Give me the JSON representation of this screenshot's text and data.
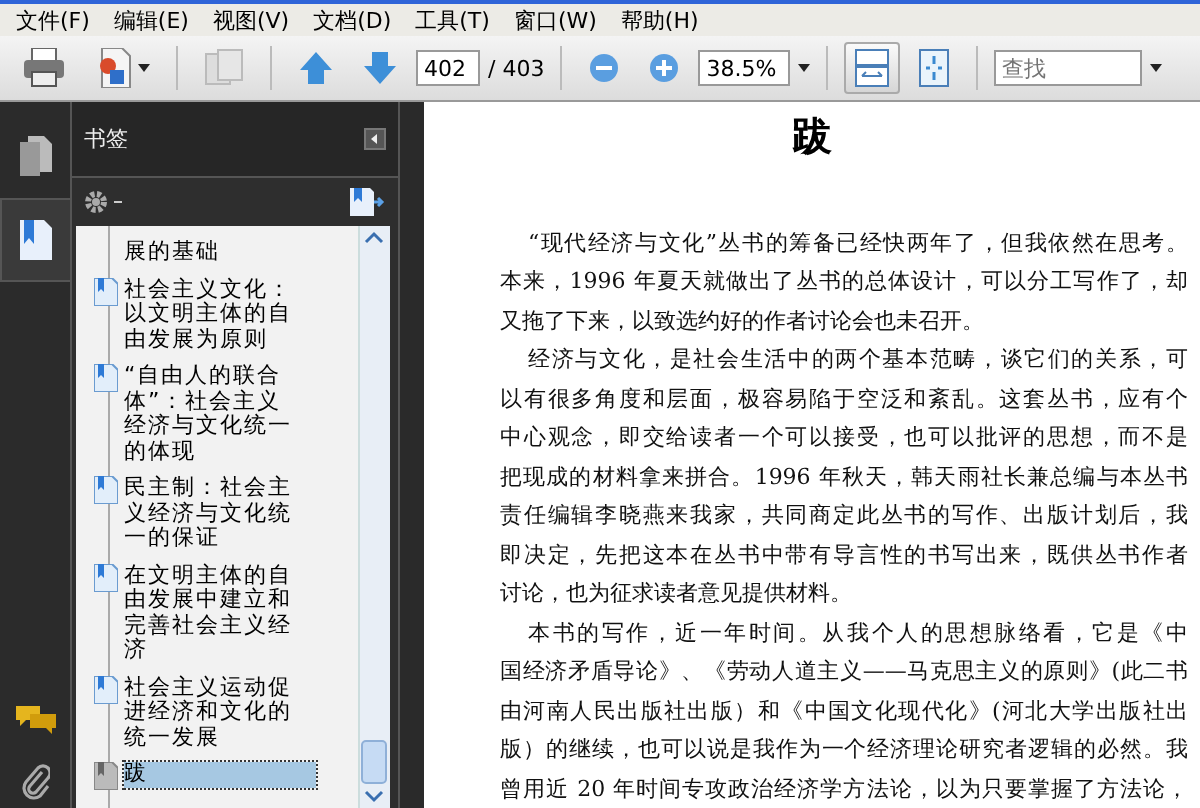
{
  "menu": [
    {
      "label": "文件(F)"
    },
    {
      "label": "编辑(E)"
    },
    {
      "label": "视图(V)"
    },
    {
      "label": "文档(D)"
    },
    {
      "label": "工具(T)"
    },
    {
      "label": "窗口(W)"
    },
    {
      "label": "帮助(H)"
    }
  ],
  "toolbar": {
    "page_field": {
      "value": "402"
    },
    "page_total": "/ 403",
    "zoom_field": {
      "value": "38.5%"
    },
    "view_buttons": [
      {
        "kind": "fit-width",
        "selected": true
      },
      {
        "kind": "fit-page",
        "selected": false
      }
    ],
    "search": {
      "placeholder": "查找"
    }
  },
  "nav_strip": {
    "items": [
      {
        "kind": "pages",
        "selected": false
      },
      {
        "kind": "bookmarks",
        "selected": true
      }
    ],
    "bottom": [
      {
        "kind": "comments"
      },
      {
        "kind": "attachments"
      }
    ]
  },
  "panel": {
    "title": "书签",
    "bookmarks": [
      {
        "kind": "continued",
        "text": "展的基础",
        "selected": false
      },
      {
        "kind": "bookmark",
        "text": "社会主义文化：以文明主体的自由发展为原则",
        "selected": false
      },
      {
        "kind": "bookmark",
        "text": "“自由人的联合体”：社会主义经济与文化统一的体现",
        "selected": false
      },
      {
        "kind": "bookmark",
        "text": "民主制：社会主义经济与文化统一的保证",
        "selected": false
      },
      {
        "kind": "bookmark",
        "text": "在文明主体的自由发展中建立和完善社会主义经济",
        "selected": false
      },
      {
        "kind": "bookmark",
        "text": "社会主义运动促进经济和文化的统一发展",
        "selected": false
      },
      {
        "kind": "bookmark",
        "text": "跋",
        "selected": true
      }
    ]
  },
  "document": {
    "title": "跋",
    "paragraphs": [
      {
        "lines": [
          "“现代经济与文化”丛书的筹备已经快两年了，但我依然在思考。",
          "本来，1996 年夏天就做出了丛书的总体设计，可以分工写作了，却",
          "又拖了下来，以致选约好的作者讨论会也未召开。"
        ]
      },
      {
        "lines": [
          "经济与文化，是社会生活中的两个基本范畴，谈它们的关系，可",
          "以有很多角度和层面，极容易陷于空泛和紊乱。这套丛书，应有个",
          "中心观念，即交给读者一个可以接受，也可以批评的思想，而不是",
          "把现成的材料拿来拼合。1996 年秋天，韩天雨社长兼总编与本丛书",
          "责任编辑李晓燕来我家，共同商定此丛书的写作、出版计划后，我",
          "即决定，先把这本在丛书中带有导言性的书写出来，既供丛书作者",
          "讨论，也为征求读者意见提供材料。"
        ]
      },
      {
        "lines": [
          "本书的写作，近一年时间。从我个人的思想脉络看，它是《中",
          "国经济矛盾导论》、《劳动人道主义——马克思主义的原则》(此二书",
          "由河南人民出版社出版）和《中国文化现代化》(河北大学出版社出",
          "版）的继续，也可以说是我作为一个经济理论研究者逻辑的必然。我",
          "曾用近 20 年时间专攻政治经济学方法论，以为只要掌握了方法论，"
        ]
      }
    ]
  }
}
